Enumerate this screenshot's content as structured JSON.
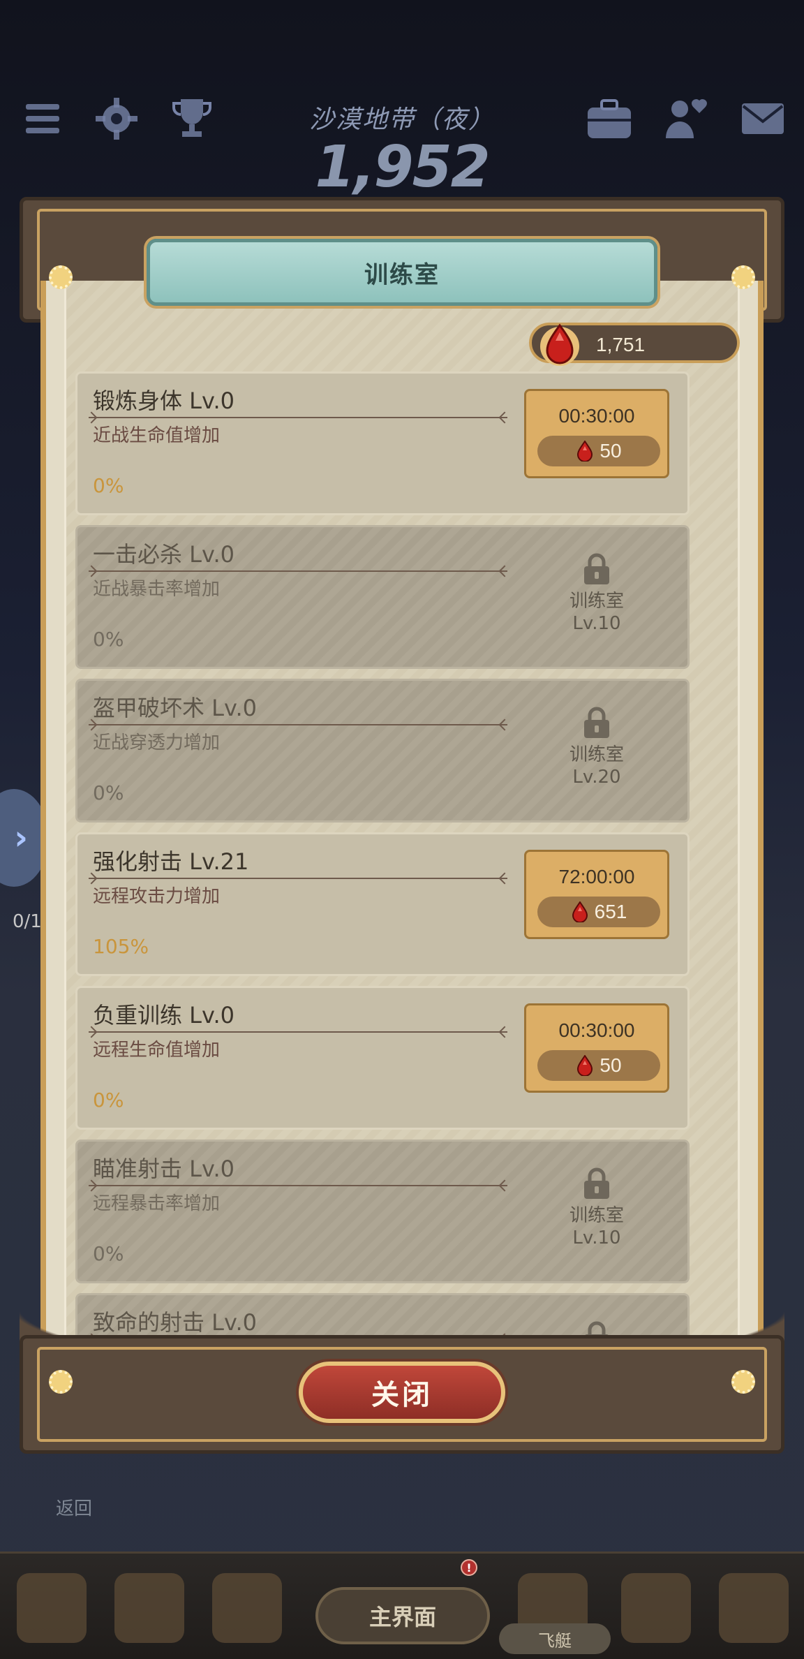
{
  "background": {
    "zone_title": "沙漠地带（夜）",
    "score": "1,952",
    "top_icons_left": [
      "menu-icon",
      "gear-icon",
      "trophy-icon"
    ],
    "top_icons_right": [
      "toolbox-icon",
      "friends-icon",
      "mail-icon"
    ],
    "side_arrow": "›",
    "progress_text": "0/1",
    "back_label": "返回"
  },
  "bottom_nav": {
    "main_label": "主界面",
    "airship_label": "飞艇",
    "badge": "!"
  },
  "modal": {
    "title": "训练室",
    "currency": {
      "icon": "ruby-icon",
      "value": "1,751"
    },
    "close_label": "关闭"
  },
  "items": [
    {
      "name": "锻炼身体 Lv.0",
      "desc": "近战生命值增加",
      "pct": "0%",
      "locked": false,
      "time": "00:30:00",
      "cost": "50"
    },
    {
      "name": "一击必杀 Lv.0",
      "desc": "近战暴击率增加",
      "pct": "0%",
      "locked": true,
      "lock_room": "训练室",
      "lock_level": "Lv.10"
    },
    {
      "name": "盔甲破坏术 Lv.0",
      "desc": "近战穿透力增加",
      "pct": "0%",
      "locked": true,
      "lock_room": "训练室",
      "lock_level": "Lv.20"
    },
    {
      "name": "强化射击 Lv.21",
      "desc": "远程攻击力增加",
      "pct": "105%",
      "locked": false,
      "time": "72:00:00",
      "cost": "651"
    },
    {
      "name": "负重训练 Lv.0",
      "desc": "远程生命值增加",
      "pct": "0%",
      "locked": false,
      "time": "00:30:00",
      "cost": "50"
    },
    {
      "name": "瞄准射击 Lv.0",
      "desc": "远程暴击率增加",
      "pct": "0%",
      "locked": true,
      "lock_room": "训练室",
      "lock_level": "Lv.10"
    },
    {
      "name": "致命的射击 Lv.0",
      "desc": "",
      "pct": "",
      "locked": true,
      "lock_room": "",
      "lock_level": ""
    }
  ],
  "colors": {
    "accent_gold": "#dcae66",
    "frame_brown": "#5a4a3c",
    "banner_teal": "#8ec2bc",
    "close_red": "#b0403a"
  }
}
